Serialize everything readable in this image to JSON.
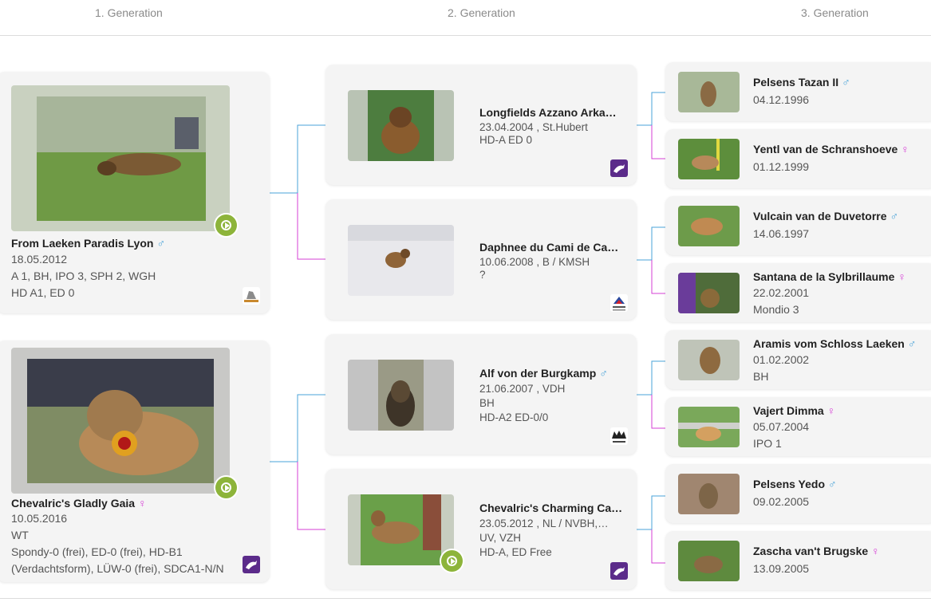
{
  "header": {
    "gen1": "1. Generation",
    "gen2": "2. Generation",
    "gen3": "3. Generation"
  },
  "colors": {
    "male_line": "#4aa3d8",
    "female_line": "#d63fd6",
    "play": "#8db43a",
    "card_bg": "#f4f4f4"
  },
  "gen1": [
    {
      "name": "From Laeken Paradis Lyon",
      "sex": "♂",
      "date": "18.05.2012",
      "line2": "A 1, BH, IPO 3, SPH 2, WGH",
      "line3": "HD A1, ED 0",
      "video": true,
      "club_icon": "horse-emblem-icon"
    },
    {
      "name": "Chevalric's Gladly Gaia",
      "sex": "♀",
      "date": "10.05.2016",
      "line2": "WT",
      "line3": "Spondy-0 (frei), ED-0 (frei), HD-B1",
      "line4": "(Verdachtsform), LÜW-0 (frei), SDCA1-N/N",
      "video": true,
      "club_icon": "purple-dog-logo-icon"
    }
  ],
  "gen2": [
    {
      "name": "Longfields Azzano Arka…",
      "line1": "23.04.2004 , St.Hubert",
      "line2": "HD-A ED 0",
      "line3": "",
      "club_icon": "purple-dog-logo-icon"
    },
    {
      "name": "Daphnee du Cami de Ca…",
      "line1": "10.06.2008 , B / KMSH",
      "line2": "?",
      "line3": "",
      "club_icon": "centrale-canine-logo-icon"
    },
    {
      "name": "Alf von der Burgkamp",
      "sex": "♂",
      "line1": "21.06.2007 , VDH",
      "line2": "BH",
      "line3": "HD-A2 ED-0/0",
      "club_icon": "dog-heads-logo-icon"
    },
    {
      "name": "Chevalric's Charming Ca…",
      "line1": "23.05.2012 , NL / NVBH,…",
      "line2": "UV, VZH",
      "line3": "HD-A, ED Free",
      "video": true,
      "club_icon": "purple-dog-logo-icon"
    }
  ],
  "gen3": [
    {
      "name": "Pelsens Tazan II",
      "sex": "♂",
      "date": "04.12.1996",
      "extra": ""
    },
    {
      "name": "Yentl van de Schranshoeve",
      "sex": "♀",
      "date": "01.12.1999",
      "extra": ""
    },
    {
      "name": "Vulcain van de Duvetorre",
      "sex": "♂",
      "date": "14.06.1997",
      "extra": ""
    },
    {
      "name": "Santana de la Sylbrillaume",
      "sex": "♀",
      "date": "22.02.2001",
      "extra": "Mondio 3"
    },
    {
      "name": "Aramis vom Schloss Laeken",
      "sex": "♂",
      "date": "01.02.2002",
      "extra": "BH"
    },
    {
      "name": "Vajert Dimma",
      "sex": "♀",
      "date": "05.07.2004",
      "extra": "IPO 1"
    },
    {
      "name": "Pelsens Yedo",
      "sex": "♂",
      "date": "09.02.2005",
      "extra": ""
    },
    {
      "name": "Zascha van't Brugske",
      "sex": "♀",
      "date": "13.09.2005",
      "extra": ""
    }
  ]
}
